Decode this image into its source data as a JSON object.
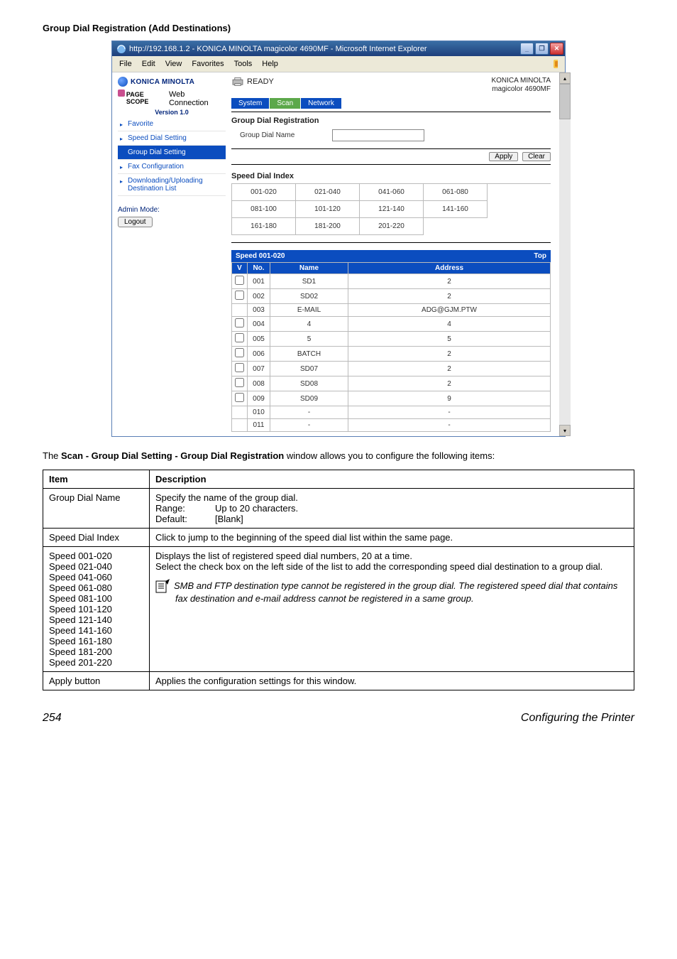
{
  "heading": "Group Dial Registration (Add Destinations)",
  "ie": {
    "title": "http://192.168.1.2 - KONICA MINOLTA magicolor 4690MF - Microsoft Internet Explorer",
    "menu": [
      "File",
      "Edit",
      "View",
      "Favorites",
      "Tools",
      "Help"
    ]
  },
  "left": {
    "brand": "KONICA MINOLTA",
    "pagescope_prefix": "PAGE SCOPE",
    "pagescope_label": "Web Connection",
    "version": "Version 1.0",
    "nav": [
      "Favorite",
      "Speed Dial Setting",
      "Group Dial Setting",
      "Fax Configuration",
      "Downloading/Uploading Destination List"
    ],
    "admin_label": "Admin Mode:",
    "logout": "Logout"
  },
  "right": {
    "ready": "READY",
    "km1": "KONICA MINOLTA",
    "km2": "magicolor 4690MF",
    "tabs": [
      "System",
      "Scan",
      "Network"
    ],
    "form_title": "Group Dial Registration",
    "field_label": "Group Dial Name",
    "apply": "Apply",
    "clear": "Clear",
    "index_title": "Speed Dial Index",
    "index": [
      "001-020",
      "021-040",
      "041-060",
      "061-080",
      "081-100",
      "101-120",
      "121-140",
      "141-160",
      "161-180",
      "181-200",
      "201-220"
    ],
    "speed_hdr_left": "Speed 001-020",
    "speed_hdr_right": "Top",
    "cols": {
      "v": "V",
      "no": "No.",
      "name": "Name",
      "address": "Address"
    },
    "rows": [
      {
        "cb": true,
        "no": "001",
        "name": "SD1",
        "addr": "2"
      },
      {
        "cb": true,
        "no": "002",
        "name": "SD02",
        "addr": "2"
      },
      {
        "cb": false,
        "no": "003",
        "name": "E-MAIL",
        "addr": "ADG@GJM.PTW"
      },
      {
        "cb": true,
        "no": "004",
        "name": "4",
        "addr": "4"
      },
      {
        "cb": true,
        "no": "005",
        "name": "5",
        "addr": "5"
      },
      {
        "cb": true,
        "no": "006",
        "name": "BATCH",
        "addr": "2"
      },
      {
        "cb": true,
        "no": "007",
        "name": "SD07",
        "addr": "2"
      },
      {
        "cb": true,
        "no": "008",
        "name": "SD08",
        "addr": "2"
      },
      {
        "cb": true,
        "no": "009",
        "name": "SD09",
        "addr": "9"
      },
      {
        "cb": false,
        "no": "010",
        "name": "-",
        "addr": "-"
      },
      {
        "cb": false,
        "no": "011",
        "name": "-",
        "addr": "-"
      }
    ]
  },
  "para_prefix": "The ",
  "para_bold": "Scan - Group Dial Setting - Group Dial Registration",
  "para_suffix": " window allows you to configure the following items:",
  "desc_headers": {
    "item": "Item",
    "desc": "Description"
  },
  "desc_rows": {
    "r1": {
      "item": "Group Dial Name",
      "d1": "Specify the name of the group dial.",
      "range_k": "Range:",
      "range_v": "Up to 20 characters.",
      "default_k": "Default:",
      "default_v": "[Blank]"
    },
    "r2": {
      "item": "Speed Dial Index",
      "desc": "Click to jump to the beginning of the speed dial list within the same page."
    },
    "r3": {
      "items": [
        "Speed 001-020",
        "Speed 021-040",
        "Speed 041-060",
        "Speed 061-080",
        "Speed 081-100",
        "Speed 101-120",
        "Speed 121-140",
        "Speed 141-160",
        "Speed 161-180",
        "Speed 181-200",
        "Speed 201-220"
      ],
      "d1": "Displays the list of registered speed dial numbers, 20 at a time.",
      "d2": "Select the check box on the left side of the list to add the corresponding speed dial destination to a group dial.",
      "note": "SMB and FTP destination type cannot be registered in the group dial. The registered speed dial that contains fax destination and e-mail address cannot be registered in a same group."
    },
    "r4": {
      "item": "Apply button",
      "desc": "Applies the configuration settings for this window."
    }
  },
  "footer": {
    "page": "254",
    "title": "Configuring the Printer"
  }
}
